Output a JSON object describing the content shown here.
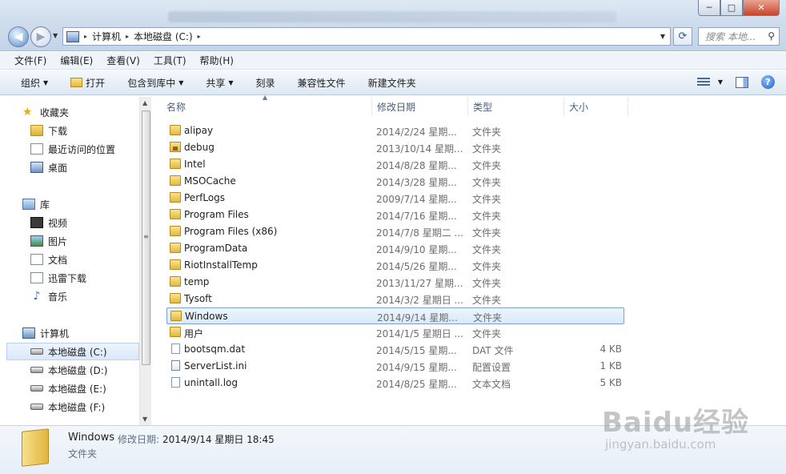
{
  "window": {
    "minimize_glyph": "─",
    "maximize_glyph": "□",
    "close_glyph": "✕"
  },
  "nav": {
    "back_glyph": "◀",
    "forward_glyph": "▶"
  },
  "address": {
    "crumbs": [
      "计算机",
      "本地磁盘 (C:)"
    ],
    "separator": "▸"
  },
  "search": {
    "placeholder": "搜索 本地..."
  },
  "menu": [
    "文件(F)",
    "编辑(E)",
    "查看(V)",
    "工具(T)",
    "帮助(H)"
  ],
  "commands": {
    "organize": "组织",
    "open": "打开",
    "include_library": "包含到库中",
    "share": "共享",
    "burn": "刻录",
    "compat_files": "兼容性文件",
    "new_folder": "新建文件夹"
  },
  "sidebar": {
    "favorites": "收藏夹",
    "downloads": "下载",
    "recent": "最近访问的位置",
    "desktop": "桌面",
    "libraries": "库",
    "videos": "视频",
    "pictures": "图片",
    "documents": "文档",
    "xunlei": "迅雷下载",
    "music": "音乐",
    "computer": "计算机",
    "drive_c": "本地磁盘 (C:)",
    "drive_d": "本地磁盘 (D:)",
    "drive_e": "本地磁盘 (E:)",
    "drive_f": "本地磁盘 (F:)"
  },
  "columns": {
    "name": "名称",
    "date": "修改日期",
    "type": "类型",
    "size": "大小"
  },
  "files": [
    {
      "name": "alipay",
      "date": "2014/2/24 星期...",
      "type": "文件夹",
      "size": "",
      "icon": "folder"
    },
    {
      "name": "debug",
      "date": "2013/10/14 星期...",
      "type": "文件夹",
      "size": "",
      "icon": "lock-folder"
    },
    {
      "name": "Intel",
      "date": "2014/8/28 星期...",
      "type": "文件夹",
      "size": "",
      "icon": "folder"
    },
    {
      "name": "MSOCache",
      "date": "2014/3/28 星期...",
      "type": "文件夹",
      "size": "",
      "icon": "folder"
    },
    {
      "name": "PerfLogs",
      "date": "2009/7/14 星期...",
      "type": "文件夹",
      "size": "",
      "icon": "folder"
    },
    {
      "name": "Program Files",
      "date": "2014/7/16 星期...",
      "type": "文件夹",
      "size": "",
      "icon": "folder"
    },
    {
      "name": "Program Files (x86)",
      "date": "2014/7/8 星期二 ...",
      "type": "文件夹",
      "size": "",
      "icon": "folder"
    },
    {
      "name": "ProgramData",
      "date": "2014/9/10 星期...",
      "type": "文件夹",
      "size": "",
      "icon": "folder"
    },
    {
      "name": "RiotInstallTemp",
      "date": "2014/5/26 星期...",
      "type": "文件夹",
      "size": "",
      "icon": "folder"
    },
    {
      "name": "temp",
      "date": "2013/11/27 星期...",
      "type": "文件夹",
      "size": "",
      "icon": "folder"
    },
    {
      "name": "Tysoft",
      "date": "2014/3/2 星期日 ...",
      "type": "文件夹",
      "size": "",
      "icon": "folder"
    },
    {
      "name": "Windows",
      "date": "2014/9/14 星期...",
      "type": "文件夹",
      "size": "",
      "icon": "folder",
      "selected": true
    },
    {
      "name": "用户",
      "date": "2014/1/5 星期日 ...",
      "type": "文件夹",
      "size": "",
      "icon": "folder"
    },
    {
      "name": "bootsqm.dat",
      "date": "2014/5/15 星期...",
      "type": "DAT 文件",
      "size": "4 KB",
      "icon": "file"
    },
    {
      "name": "ServerList.ini",
      "date": "2014/9/15 星期...",
      "type": "配置设置",
      "size": "1 KB",
      "icon": "ini-file"
    },
    {
      "name": "unintall.log",
      "date": "2014/8/25 星期...",
      "type": "文本文档",
      "size": "5 KB",
      "icon": "file"
    }
  ],
  "details": {
    "name": "Windows",
    "modified_label": "修改日期:",
    "modified_value": "2014/9/14 星期日  18:45",
    "type": "文件夹"
  },
  "watermark": {
    "main": "Baidu经验",
    "sub": "jingyan.baidu.com"
  }
}
